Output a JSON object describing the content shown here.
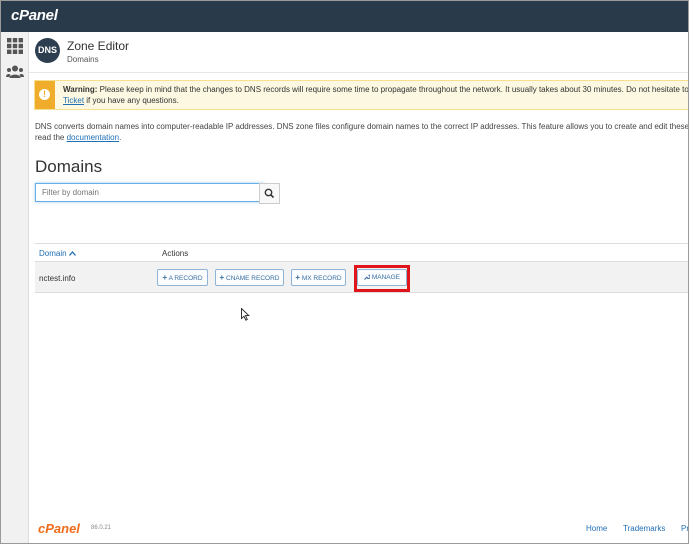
{
  "app": {
    "logo": "cPanel"
  },
  "sidebar": {
    "icons": [
      "grid-icon",
      "users-icon"
    ]
  },
  "header": {
    "badge": "DNS",
    "title": "Zone Editor",
    "breadcrumb": "Domains"
  },
  "warning": {
    "label": "Warning:",
    "text": "Please keep in mind that the changes to DNS records will require some time to propagate throughout the network. It usually takes about 30 minutes. Do not hesitate to o",
    "link": "Ticket",
    "text2": "if you have any questions."
  },
  "description": {
    "line1": "DNS converts domain names into computer-readable IP addresses. DNS zone files configure domain names to the correct IP addresses. This feature allows you to create and edit these zo",
    "line2_prefix": "read the",
    "line2_link": "documentation",
    "line2_suffix": "."
  },
  "domains": {
    "heading": "Domains",
    "filter_placeholder": "Filter by domain",
    "columns": {
      "domain": "Domain",
      "actions": "Actions"
    },
    "rows": [
      {
        "domain": "nctest.info"
      }
    ],
    "actions": {
      "a_record": "A RECORD",
      "cname_record": "CNAME RECORD",
      "mx_record": "MX RECORD",
      "manage": "MANAGE"
    }
  },
  "footer": {
    "logo": "cPanel",
    "version": "86.0.21",
    "links": [
      "Home",
      "Trademarks",
      "Pr"
    ]
  },
  "colors": {
    "topbar": "#293a4a",
    "link": "#1f6fb5",
    "highlight": "#e0141b",
    "warning_bg": "#fcf8e1",
    "warning_icon": "#f0ad2b",
    "footer_logo": "#ef6c1a"
  }
}
